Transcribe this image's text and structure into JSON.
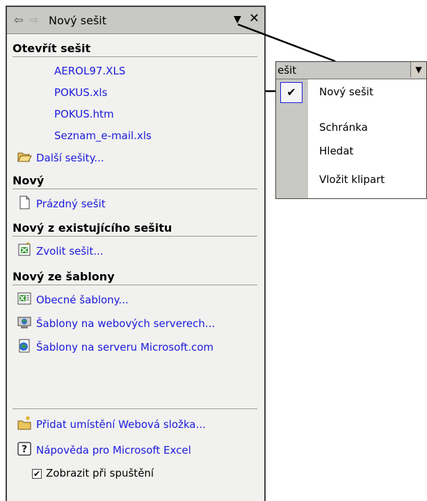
{
  "pane": {
    "back_icon": "back-arrow-icon",
    "forward_icon": "forward-arrow-icon",
    "title": "Nový sešit",
    "dropdown_icon": "dropdown-triangle-icon",
    "close_icon": "close-icon"
  },
  "sections": {
    "open": "Otevřít sešit",
    "new": "Nový",
    "new_existing": "Nový z existujícího sešitu",
    "new_template": "Nový ze šablony"
  },
  "open_files": [
    "AEROL97.XLS",
    "POKUS.xls",
    "POKUS.htm",
    "Seznam_e-mail.xls"
  ],
  "links": {
    "more_workbooks": "Další sešity...",
    "blank_workbook": "Prázdný sešit",
    "choose_workbook": "Zvolit sešit...",
    "general_templates": "Obecné šablony...",
    "web_templates": "Šablony na webových serverech...",
    "ms_templates": "Šablony na serveru Microsoft.com",
    "add_location": "Přidat umístění Webová složka...",
    "help": "Nápověda pro Microsoft Excel"
  },
  "show_at_startup": {
    "label": "Zobrazit při spuštění",
    "checked": true,
    "mark": "✔"
  },
  "popup": {
    "header": "ešit",
    "items": [
      "Nový sešit",
      "Schránka",
      "Hledat",
      "Vložit klipart"
    ],
    "selected_mark": "✔"
  }
}
